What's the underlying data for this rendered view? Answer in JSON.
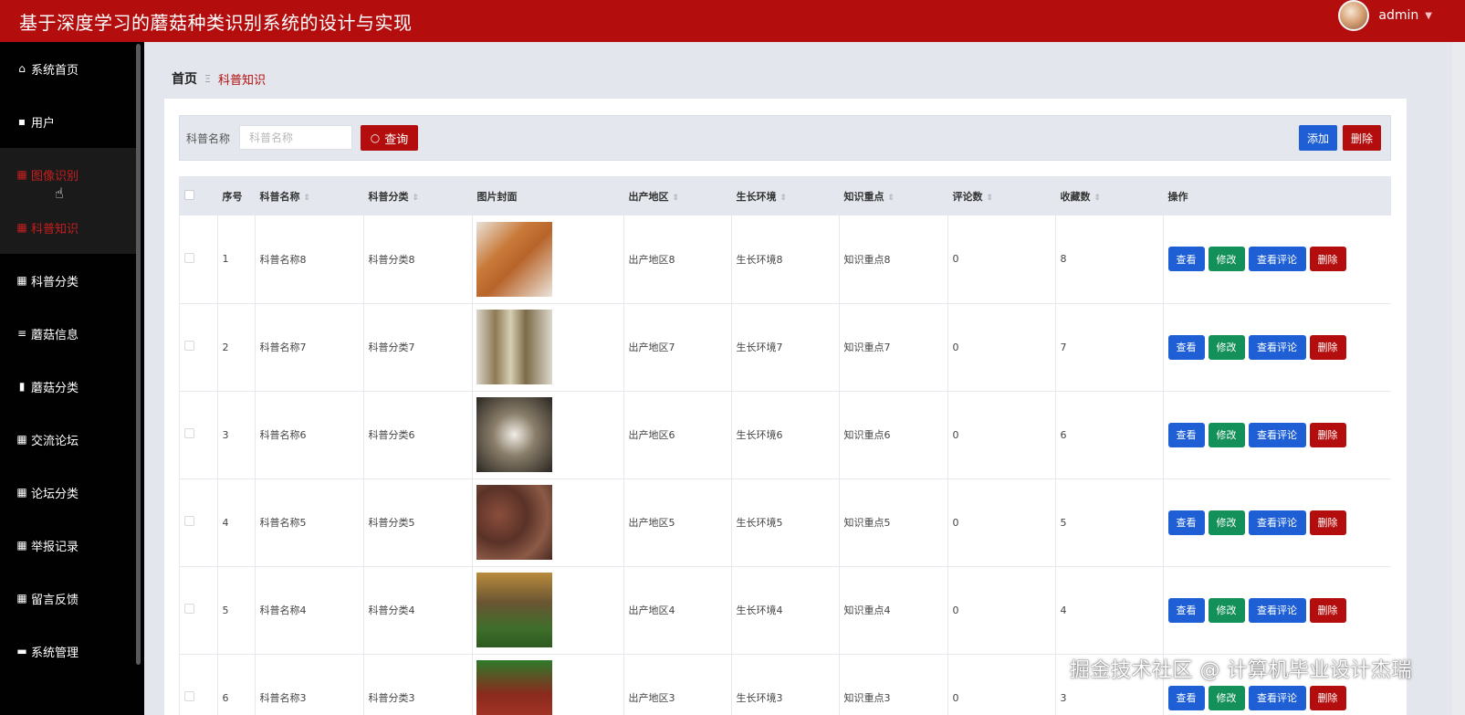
{
  "header": {
    "title": "基于深度学习的蘑菇种类识别系统的设计与实现",
    "username": "admin"
  },
  "sidebar": {
    "items": [
      {
        "label": "系统首页",
        "icon": "home-icon"
      },
      {
        "label": "用户",
        "icon": "clipboard-icon"
      },
      {
        "label": "图像识别",
        "icon": "grid-icon"
      },
      {
        "label": "科普知识",
        "icon": "grid-icon"
      },
      {
        "label": "科普分类",
        "icon": "grid-icon"
      },
      {
        "label": "蘑菇信息",
        "icon": "list-icon"
      },
      {
        "label": "蘑菇分类",
        "icon": "book-icon"
      },
      {
        "label": "交流论坛",
        "icon": "grid-icon"
      },
      {
        "label": "论坛分类",
        "icon": "grid-icon"
      },
      {
        "label": "举报记录",
        "icon": "grid-icon"
      },
      {
        "label": "留言反馈",
        "icon": "grid-icon"
      },
      {
        "label": "系统管理",
        "icon": "monitor-icon"
      }
    ]
  },
  "breadcrumb": {
    "home": "首页",
    "separator": "Ξ",
    "current": "科普知识"
  },
  "search": {
    "label": "科普名称",
    "placeholder": "科普名称",
    "query_button": "查询",
    "add_button": "添加",
    "delete_button": "删除"
  },
  "table": {
    "headers": [
      "序号",
      "科普名称",
      "科普分类",
      "图片封面",
      "出产地区",
      "生长环境",
      "知识重点",
      "评论数",
      "收藏数",
      "操作"
    ],
    "actions": {
      "view": "查看",
      "edit": "修改",
      "comments": "查看评论",
      "delete": "删除"
    },
    "rows": [
      {
        "index": "1",
        "name": "科普名称8",
        "category": "科普分类8",
        "region": "出产地区8",
        "environment": "生长环境8",
        "key_point": "知识重点8",
        "comments": "0",
        "favorites": "8"
      },
      {
        "index": "2",
        "name": "科普名称7",
        "category": "科普分类7",
        "region": "出产地区7",
        "environment": "生长环境7",
        "key_point": "知识重点7",
        "comments": "0",
        "favorites": "7"
      },
      {
        "index": "3",
        "name": "科普名称6",
        "category": "科普分类6",
        "region": "出产地区6",
        "environment": "生长环境6",
        "key_point": "知识重点6",
        "comments": "0",
        "favorites": "6"
      },
      {
        "index": "4",
        "name": "科普名称5",
        "category": "科普分类5",
        "region": "出产地区5",
        "environment": "生长环境5",
        "key_point": "知识重点5",
        "comments": "0",
        "favorites": "5"
      },
      {
        "index": "5",
        "name": "科普名称4",
        "category": "科普分类4",
        "region": "出产地区4",
        "environment": "生长环境4",
        "key_point": "知识重点4",
        "comments": "0",
        "favorites": "4"
      },
      {
        "index": "6",
        "name": "科普名称3",
        "category": "科普分类3",
        "region": "出产地区3",
        "environment": "生长环境3",
        "key_point": "知识重点3",
        "comments": "0",
        "favorites": "3"
      }
    ]
  },
  "watermark": "掘金技术社区 @ 计算机毕业设计杰瑞",
  "colors": {
    "brand": "#b30d0d",
    "primary": "#1f5fd6",
    "success": "#14915a"
  }
}
